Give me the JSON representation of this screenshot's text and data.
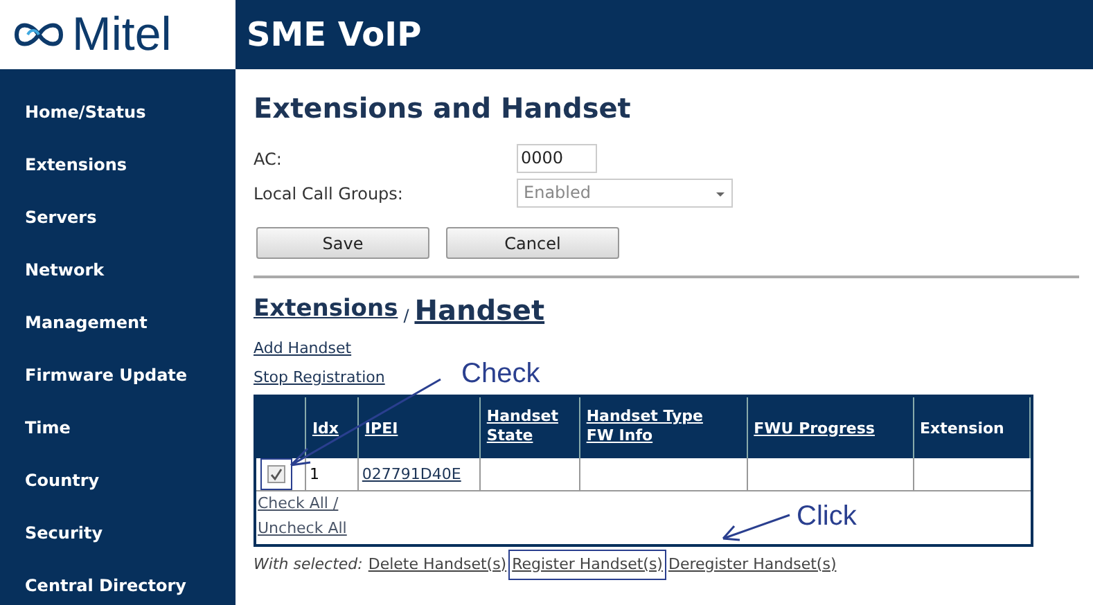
{
  "logo": {
    "text": "Mitel"
  },
  "header": {
    "title": "SME VoIP"
  },
  "sidebar": {
    "items": [
      {
        "label": "Home/Status"
      },
      {
        "label": "Extensions"
      },
      {
        "label": "Servers"
      },
      {
        "label": "Network"
      },
      {
        "label": "Management"
      },
      {
        "label": "Firmware Update"
      },
      {
        "label": "Time"
      },
      {
        "label": "Country"
      },
      {
        "label": "Security"
      },
      {
        "label": "Central Directory"
      }
    ]
  },
  "page_title": "Extensions and Handset",
  "form": {
    "fields": [
      {
        "kind": "text",
        "label": "AC:",
        "value": "0000"
      },
      {
        "kind": "select",
        "label": "Local Call Groups:",
        "value": "Enabled"
      }
    ],
    "buttons": [
      "Save",
      "Cancel"
    ]
  },
  "section": {
    "crumb": "Extensions",
    "separator": "/",
    "title": "Handset"
  },
  "links": [
    "Add Handset",
    "Stop Registration"
  ],
  "table": {
    "columns": [
      {
        "label": "Idx",
        "link": true
      },
      {
        "label": "IPEI",
        "link": true
      },
      {
        "label": "Handset State",
        "link": true
      },
      {
        "label": "Handset Type FW Info",
        "link": true
      },
      {
        "label": "FWU Progress",
        "link": true
      },
      {
        "label": "Extension",
        "link": false
      }
    ],
    "rows": [
      {
        "checked": true,
        "idx": "1",
        "ipei": "027791D40E"
      }
    ],
    "check_all": "Check All /",
    "uncheck_all": "Uncheck All"
  },
  "actions": {
    "label": "With selected:",
    "links": [
      "Delete Handset(s)",
      "Register Handset(s)",
      "Deregister Handset(s)"
    ]
  },
  "annotations": [
    {
      "text": "Check"
    },
    {
      "text": "Click"
    }
  ]
}
